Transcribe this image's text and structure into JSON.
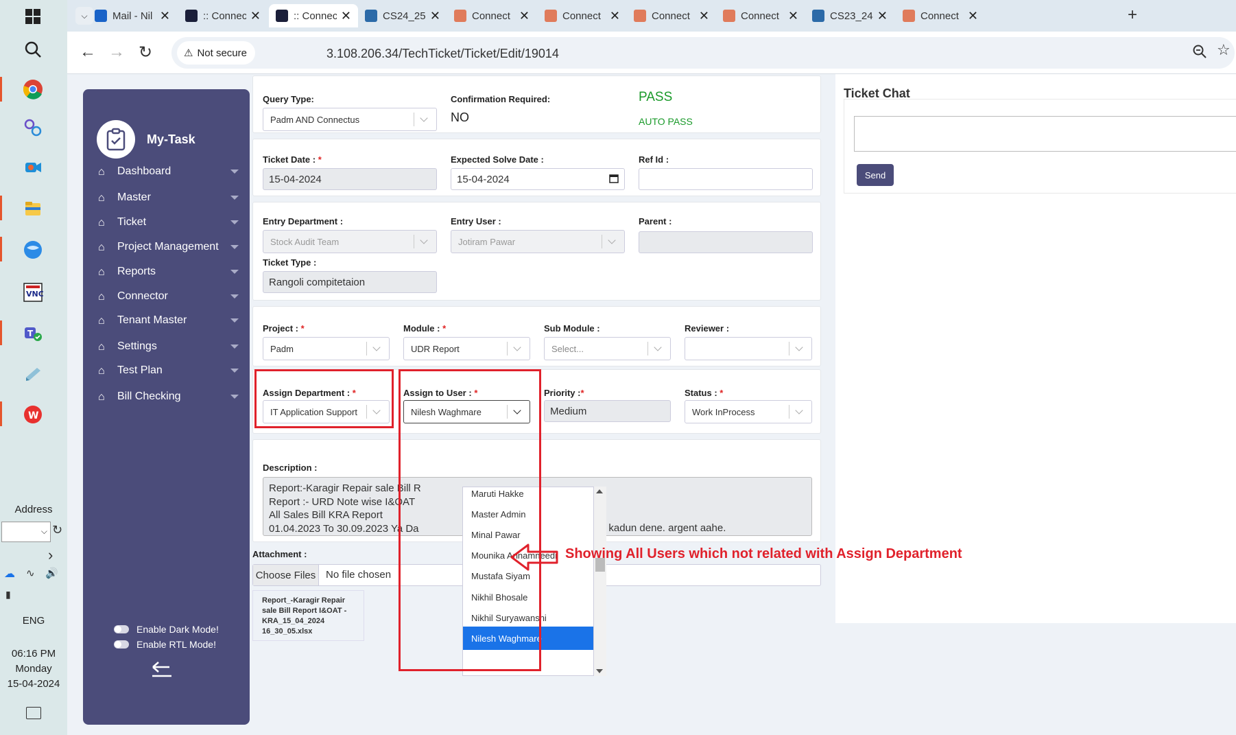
{
  "taskbar": {
    "address_label": "Address",
    "language": "ENG",
    "time": "06:16 PM",
    "day": "Monday",
    "date": "15-04-2024"
  },
  "tabs": [
    {
      "title": "Mail - Nil",
      "color": "#1a63c8"
    },
    {
      "title": ":: Connec",
      "color": "#1b1f3a"
    },
    {
      "title": ":: Connec",
      "color": "#1b1f3a",
      "active": true
    },
    {
      "title": "CS24_25-",
      "color": "#2c6aa8"
    },
    {
      "title": "Connect",
      "color": "#e07b5b"
    },
    {
      "title": "Connect",
      "color": "#e07b5b"
    },
    {
      "title": "Connect",
      "color": "#e07b5b"
    },
    {
      "title": "Connect",
      "color": "#e07b5b"
    },
    {
      "title": "CS23_24-",
      "color": "#2c6aa8"
    },
    {
      "title": "Connect",
      "color": "#e07b5b"
    }
  ],
  "address_bar": {
    "security_label": "Not secure",
    "url": "3.108.206.34/TechTicket/Ticket/Edit/19014"
  },
  "sidebar": {
    "brand": "My-Task",
    "items": [
      "Dashboard",
      "Master",
      "Ticket",
      "Project Management",
      "Reports",
      "Connector",
      "Tenant Master",
      "Settings",
      "Test Plan",
      "Bill Checking"
    ],
    "dark_mode_label": "Enable Dark Mode!",
    "rtl_mode_label": "Enable RTL Mode!"
  },
  "form": {
    "query_type_label": "Query Type:",
    "query_type_value": "Padm AND Connectus",
    "confirmation_label": "Confirmation Required:",
    "confirmation_value": "NO",
    "pass_label": "PASS",
    "auto_pass_label": "AUTO PASS",
    "ticket_date_label": "Ticket Date :",
    "ticket_date_value": "15-04-2024",
    "expected_date_label": "Expected Solve Date :",
    "expected_date_value": "15-04-2024",
    "ref_id_label": "Ref Id :",
    "ref_id_value": "",
    "entry_dept_label": "Entry Department :",
    "entry_dept_value": "Stock Audit Team",
    "entry_user_label": "Entry User :",
    "entry_user_value": "Jotiram Pawar",
    "parent_label": "Parent :",
    "ticket_type_label": "Ticket Type :",
    "ticket_type_value": "Rangoli compitetaion",
    "project_label": "Project :",
    "project_value": "Padm",
    "module_label": "Module :",
    "module_value": "UDR Report",
    "sub_module_label": "Sub Module :",
    "sub_module_value": "Select...",
    "reviewer_label": "Reviewer :",
    "reviewer_value": "",
    "assign_dept_label": "Assign Department :",
    "assign_dept_value": "IT Application Support",
    "assign_user_label": "Assign to User :",
    "assign_user_value": "Nilesh Waghmare",
    "priority_label": "Priority :",
    "priority_value": "Medium",
    "status_label": "Status :",
    "status_value": "Work InProcess",
    "description_label": "Description :",
    "description_lines": [
      "Report:-Karagir Repair sale Bill R",
      "Report :- URD Note wise I&OAT",
      "All Sales Bill KRA Report",
      "01.04.2023 To 30.09.2023 Ya Da"
    ],
    "description_tail": "e Cha Report kadun dene. argent aahe.",
    "attachment_label": "Attachment :",
    "choose_files_label": "Choose Files",
    "no_file_label": "No file chosen",
    "attachment_file": "Report_-Karagir Repair sale Bill Report I&OAT - KRA_15_04_2024 16_30_05.xlsx"
  },
  "dropdown_options": [
    "Maruti Hakke",
    "Master Admin",
    "Minal Pawar",
    "Mounika Annamneedi",
    "Mustafa Siyam",
    "Nikhil Bhosale",
    "Nikhil Suryawanshi",
    "Nilesh Waghmare"
  ],
  "dropdown_selected": "Nilesh Waghmare",
  "annotation": "Showing All Users which not  related with Assign Department",
  "chat": {
    "title": "Ticket Chat",
    "send_label": "Send"
  },
  "colors": {
    "sidebar_bg": "#4b4c7a",
    "pass_green": "#1a9a2a",
    "annotation_red": "#e0212b",
    "send_button": "#4b4c7a",
    "selected_option": "#1a73e8"
  }
}
